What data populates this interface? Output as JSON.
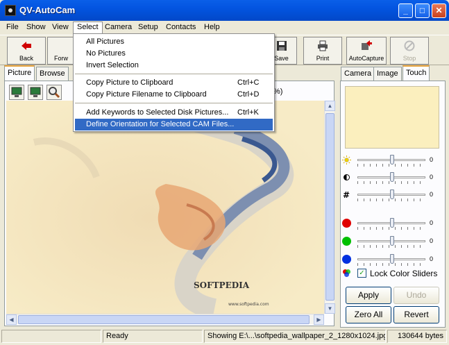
{
  "window": {
    "title": "QV-AutoCam"
  },
  "menu": [
    "File",
    "Show",
    "View",
    "Select",
    "Camera",
    "Setup",
    "Contacts",
    "Help"
  ],
  "select_menu": {
    "items": [
      {
        "label": "All Pictures",
        "shortcut": ""
      },
      {
        "label": "No Pictures",
        "shortcut": ""
      },
      {
        "label": "Invert Selection",
        "shortcut": ""
      },
      {
        "label": "Copy Picture to Clipboard",
        "shortcut": "Ctrl+C"
      },
      {
        "label": "Copy Picture Filename to Clipboard",
        "shortcut": "Ctrl+D"
      },
      {
        "label": "Add Keywords to Selected Disk Pictures...",
        "shortcut": "Ctrl+K"
      },
      {
        "label": "Define Orientation for Selected CAM Files...",
        "shortcut": ""
      }
    ]
  },
  "toolbar": {
    "back": "Back",
    "forward": "Forw",
    "save": "Save",
    "print": "Print",
    "autocapture": "AutoCapture",
    "stop": "Stop"
  },
  "left_tabs": [
    "Picture",
    "Browse"
  ],
  "right_tabs": [
    "Camera",
    "Image",
    "Touch"
  ],
  "zoom_fragment": "%)",
  "sliders": [
    {
      "icon": "brightness-icon",
      "value": "0"
    },
    {
      "icon": "contrast-icon",
      "value": "0"
    },
    {
      "icon": "sharpness-icon",
      "value": "0"
    },
    {
      "icon": "red-icon",
      "value": "0",
      "color": "#e00000"
    },
    {
      "icon": "green-icon",
      "value": "0",
      "color": "#00c000"
    },
    {
      "icon": "blue-icon",
      "value": "0",
      "color": "#0030e0"
    }
  ],
  "lock_label": "Lock Color Sliders",
  "buttons": {
    "apply": "Apply",
    "undo": "Undo",
    "zero_all": "Zero All",
    "revert": "Revert"
  },
  "image": {
    "brand": "SOFTPEDIA",
    "url": "www.softpedia.com"
  },
  "status": {
    "ready": "Ready",
    "showing": "Showing E:\\...\\softpedia_wallpaper_2_1280x1024.jpg",
    "size": "130644 bytes"
  }
}
